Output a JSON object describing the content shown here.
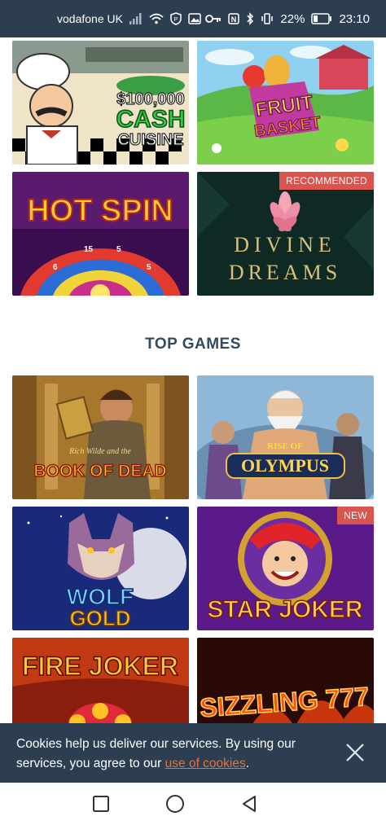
{
  "status_bar": {
    "carrier": "vodafone UK",
    "battery": "22%",
    "time": "23:10"
  },
  "promo_tiles": [
    {
      "title": "$100,000 CASH CUISINE",
      "badge": ""
    },
    {
      "title": "FRUIT BASKET",
      "badge": ""
    },
    {
      "title": "HOT SPIN",
      "badge": ""
    },
    {
      "title": "DIVINE DREAMS",
      "badge": "RECOMMENDED"
    }
  ],
  "section": {
    "title": "TOP GAMES"
  },
  "top_games": [
    {
      "title": "BOOK OF DEAD",
      "subtitle": "Rich Wilde and the",
      "badge": ""
    },
    {
      "title": "OLYMPUS",
      "subtitle": "RISE OF",
      "badge": ""
    },
    {
      "title": "WOLF GOLD",
      "subtitle": "",
      "badge": ""
    },
    {
      "title": "STAR JOKER",
      "subtitle": "",
      "badge": "NEW"
    },
    {
      "title": "FIRE JOKER",
      "subtitle": "",
      "badge": ""
    },
    {
      "title": "SIZZLING 777",
      "subtitle": "",
      "badge": ""
    }
  ],
  "cookie_banner": {
    "text_before": "Cookies help us deliver our services. By using our services, you agree to our ",
    "link": "use of cookies",
    "text_after": "."
  },
  "colors": {
    "status_bar": "#2c3e50",
    "heading": "#34495e",
    "cookie_bg": "#2c3e50",
    "link": "#e3743c",
    "badge": "#d9534f"
  }
}
